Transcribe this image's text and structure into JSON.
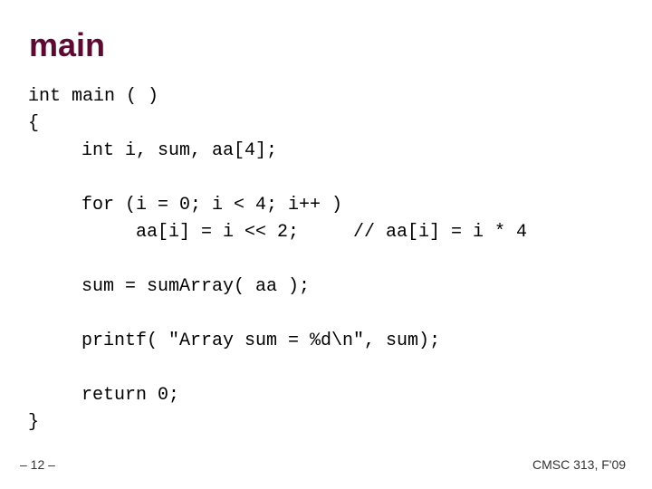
{
  "slide": {
    "title": "main",
    "code_lines": [
      "int main ( )",
      "{",
      "int i, sum, aa[4];",
      "for (i = 0; i < 4; i++ )",
      "aa[i] = i << 2;",
      "// aa[i] = i * 4",
      "sum = sumArray( aa );",
      "printf( \"Array sum = %d\\n\", sum);",
      "return 0;",
      "}"
    ],
    "page_number": "– 12 –",
    "course": "CMSC 313, F'09"
  }
}
